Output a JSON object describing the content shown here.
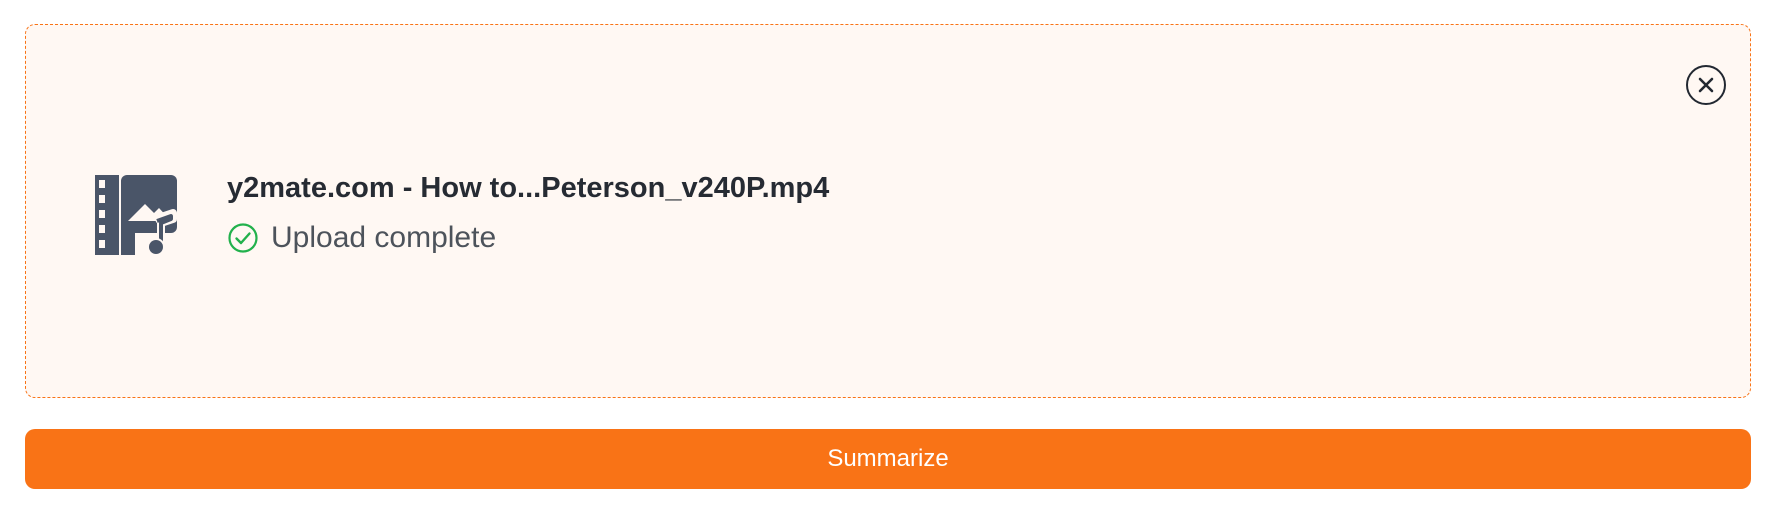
{
  "upload": {
    "file_name": "y2mate.com - How to...Peterson_v240P.mp4",
    "status": "Upload complete",
    "file_icon": "media-file-icon",
    "status_icon": "check-circle-icon",
    "close_icon": "close-icon"
  },
  "actions": {
    "summarize_label": "Summarize"
  },
  "colors": {
    "accent": "#f97316",
    "card_background": "#fff8f3",
    "success": "#22b14c",
    "icon_slate": "#4a5568",
    "text_dark": "#262b33",
    "text_muted": "#4d535b"
  }
}
